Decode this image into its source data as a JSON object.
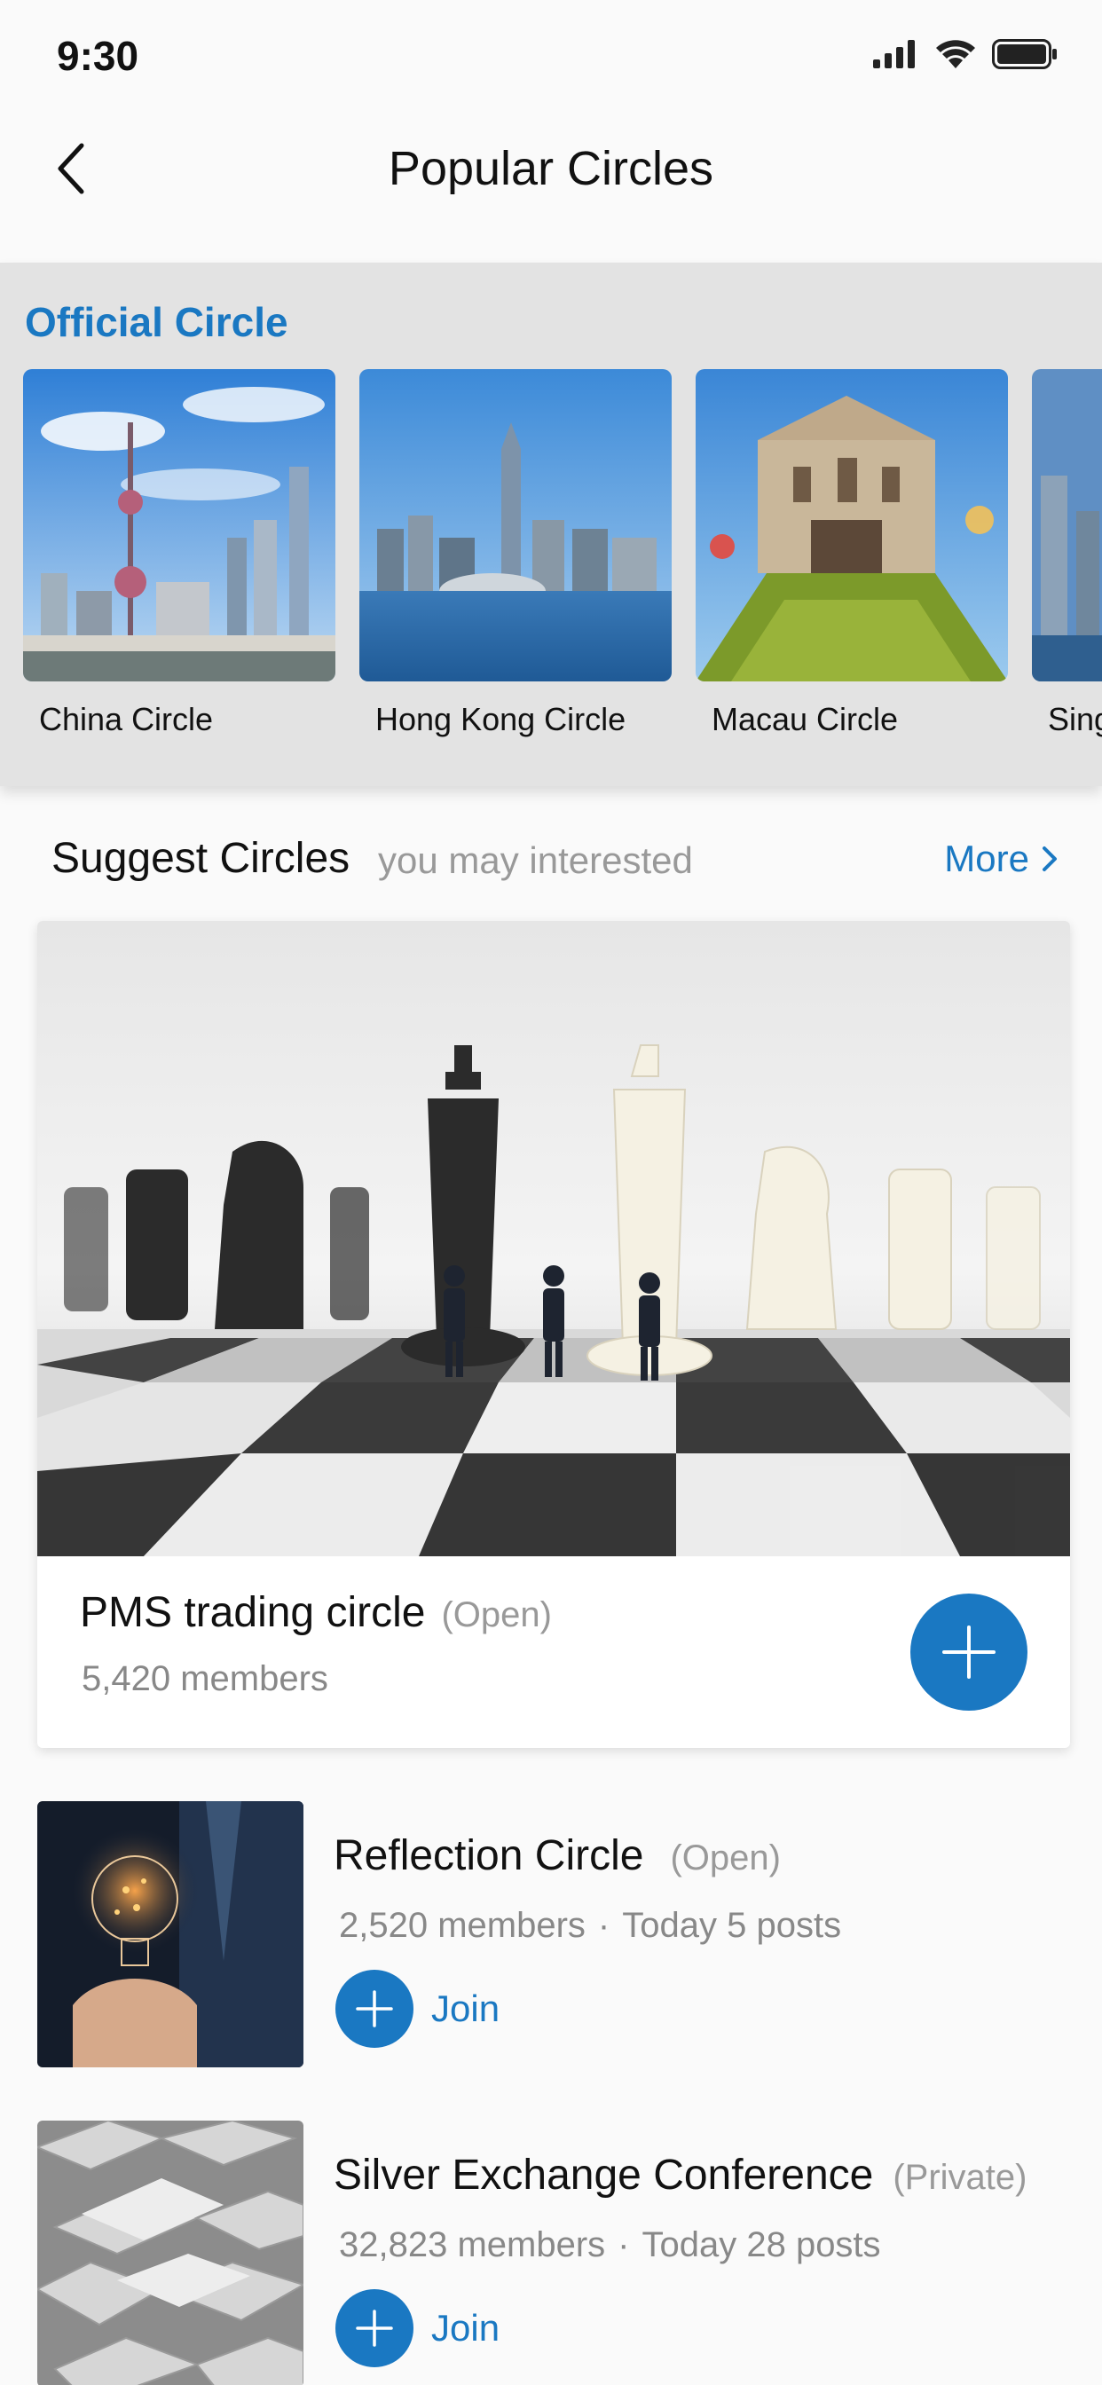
{
  "status_bar": {
    "time": "9:30"
  },
  "nav": {
    "title": "Popular Circles"
  },
  "official": {
    "title": "Official Circle",
    "circles": [
      {
        "name": "China Circle"
      },
      {
        "name": "Hong Kong Circle"
      },
      {
        "name": "Macau Circle"
      },
      {
        "name": "Sing"
      }
    ]
  },
  "suggest": {
    "title": "Suggest Circles",
    "subtitle": "you may interested",
    "more_label": "More",
    "featured": {
      "name": "PMS trading circle",
      "tag": "(Open)",
      "members": "5,420 members"
    },
    "items": [
      {
        "name": "Reflection Circle",
        "tag": "(Open)",
        "members": "2,520 members",
        "posts": "Today 5 posts",
        "join_label": "Join"
      },
      {
        "name": "Silver Exchange Conference",
        "tag": "(Private)",
        "members": "32,823 members",
        "posts": "Today 28 posts",
        "join_label": "Join"
      }
    ],
    "separator": "·"
  },
  "colors": {
    "accent": "#1a78c2",
    "section_bg": "#e3e3e3",
    "muted_text": "#999999"
  }
}
